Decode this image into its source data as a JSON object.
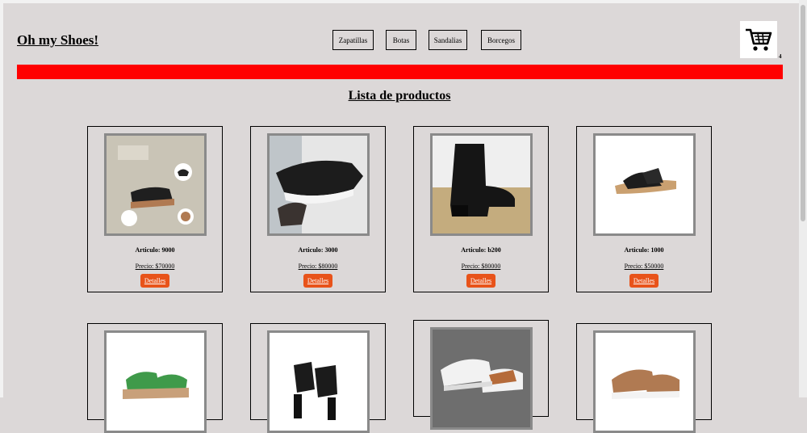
{
  "header": {
    "brand": "Oh my Shoes!",
    "nav": [
      "Zapatillas",
      "Botas",
      "Sandalias",
      "Borcegos"
    ],
    "cart_count": "4",
    "cart_icon": "shopping-cart-icon"
  },
  "main": {
    "title": "Lista de productos",
    "details_label": "Detalles",
    "products": [
      {
        "article": "Articulo: 9000",
        "price": "Precio: $70000"
      },
      {
        "article": "Articulo: 3000",
        "price": "Precio: $80000"
      },
      {
        "article": "Articulo: b200",
        "price": "Precio: $80000"
      },
      {
        "article": "Articulo: 1000",
        "price": "Precio: $50000"
      },
      {
        "article": "",
        "price": ""
      },
      {
        "article": "",
        "price": ""
      },
      {
        "article": "",
        "price": ""
      },
      {
        "article": "",
        "price": ""
      }
    ]
  },
  "colors": {
    "accent_bar": "#ff0000",
    "button": "#e8531a",
    "background": "#dcd8d8"
  }
}
